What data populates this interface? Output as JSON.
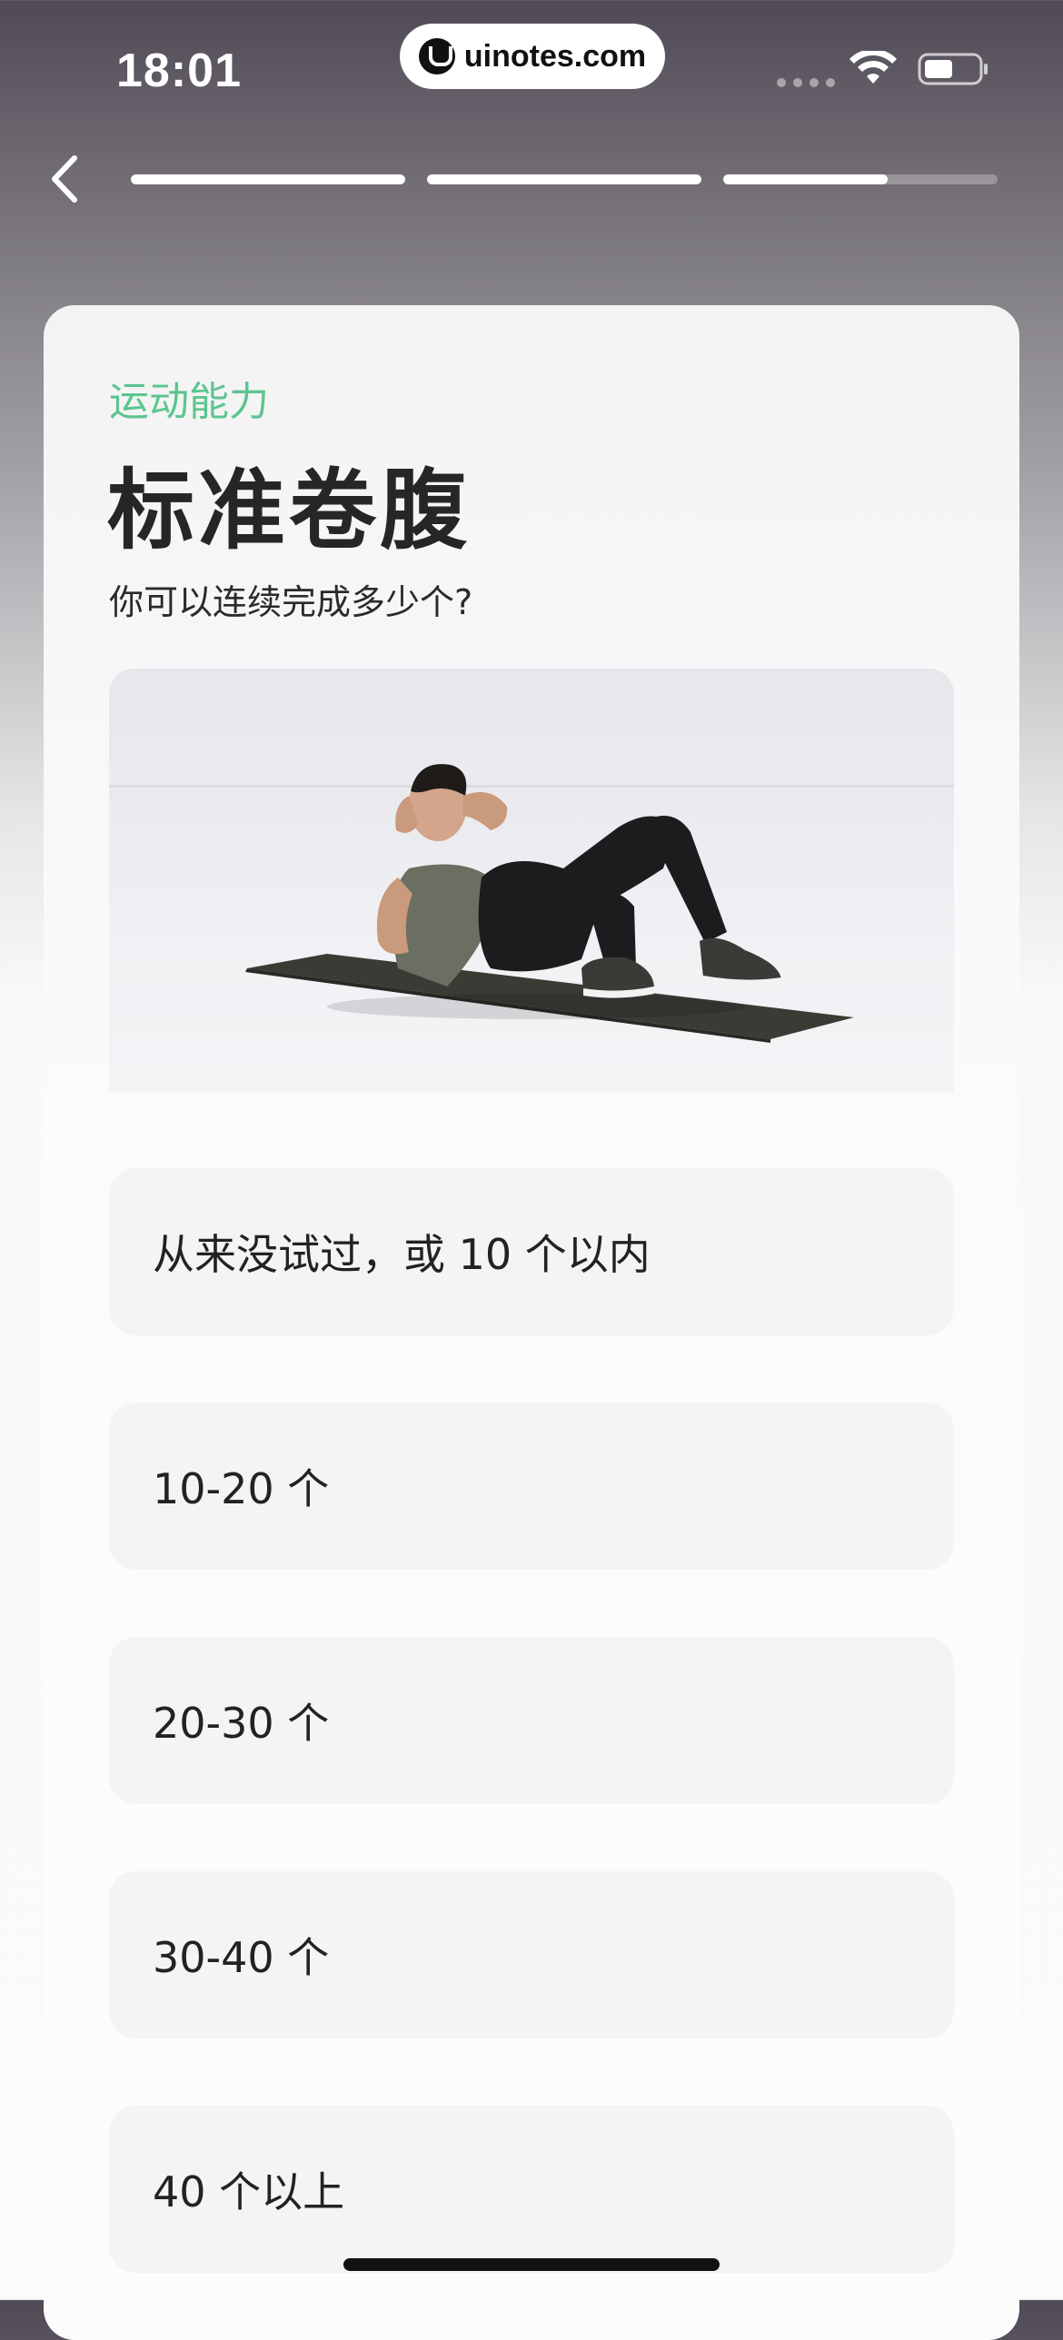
{
  "status_bar": {
    "time": "18:01",
    "url": "uinotes.com"
  },
  "progress": {
    "segments": [
      {
        "fill": 1.0
      },
      {
        "fill": 1.0
      },
      {
        "fill": 0.6
      }
    ]
  },
  "card": {
    "category": "运动能力",
    "title": "标准卷腹",
    "question": "你可以连续完成多少个?",
    "image_icon": "crunch-exercise-illustration"
  },
  "options": [
    {
      "label": "从来没试过，或 10 个以内"
    },
    {
      "label": "10-20 个"
    },
    {
      "label": "20-30 个"
    },
    {
      "label": "30-40 个"
    },
    {
      "label": "40 个以上"
    }
  ],
  "colors": {
    "accent": "#5cc58f",
    "text": "#262626",
    "option_bg": "#f4f4f4"
  }
}
